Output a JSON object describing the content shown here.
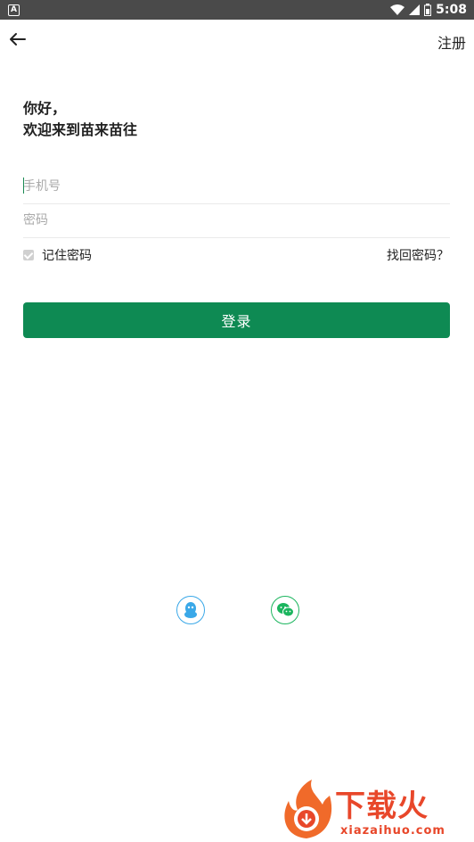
{
  "status_bar": {
    "time": "5:08",
    "app_icon": "A"
  },
  "header": {
    "back_icon": "arrow-left-icon",
    "register_label": "注册"
  },
  "greeting": {
    "line1": "你好，",
    "line2": "欢迎来到苗来苗往"
  },
  "form": {
    "phone_placeholder": "手机号",
    "password_placeholder": "密码",
    "remember_label": "记住密码",
    "remember_checked": true,
    "forgot_label": "找回密码？",
    "login_label": "登录"
  },
  "social": {
    "qq_icon": "qq-icon",
    "wechat_icon": "wechat-icon"
  },
  "watermark": {
    "brand_cn": "下载火",
    "brand_en": "xiazaihuo.com"
  },
  "colors": {
    "primary": "#0e8a53",
    "qq": "#3aa8e8",
    "wechat": "#1bb55e",
    "watermark": "#e8472a"
  }
}
